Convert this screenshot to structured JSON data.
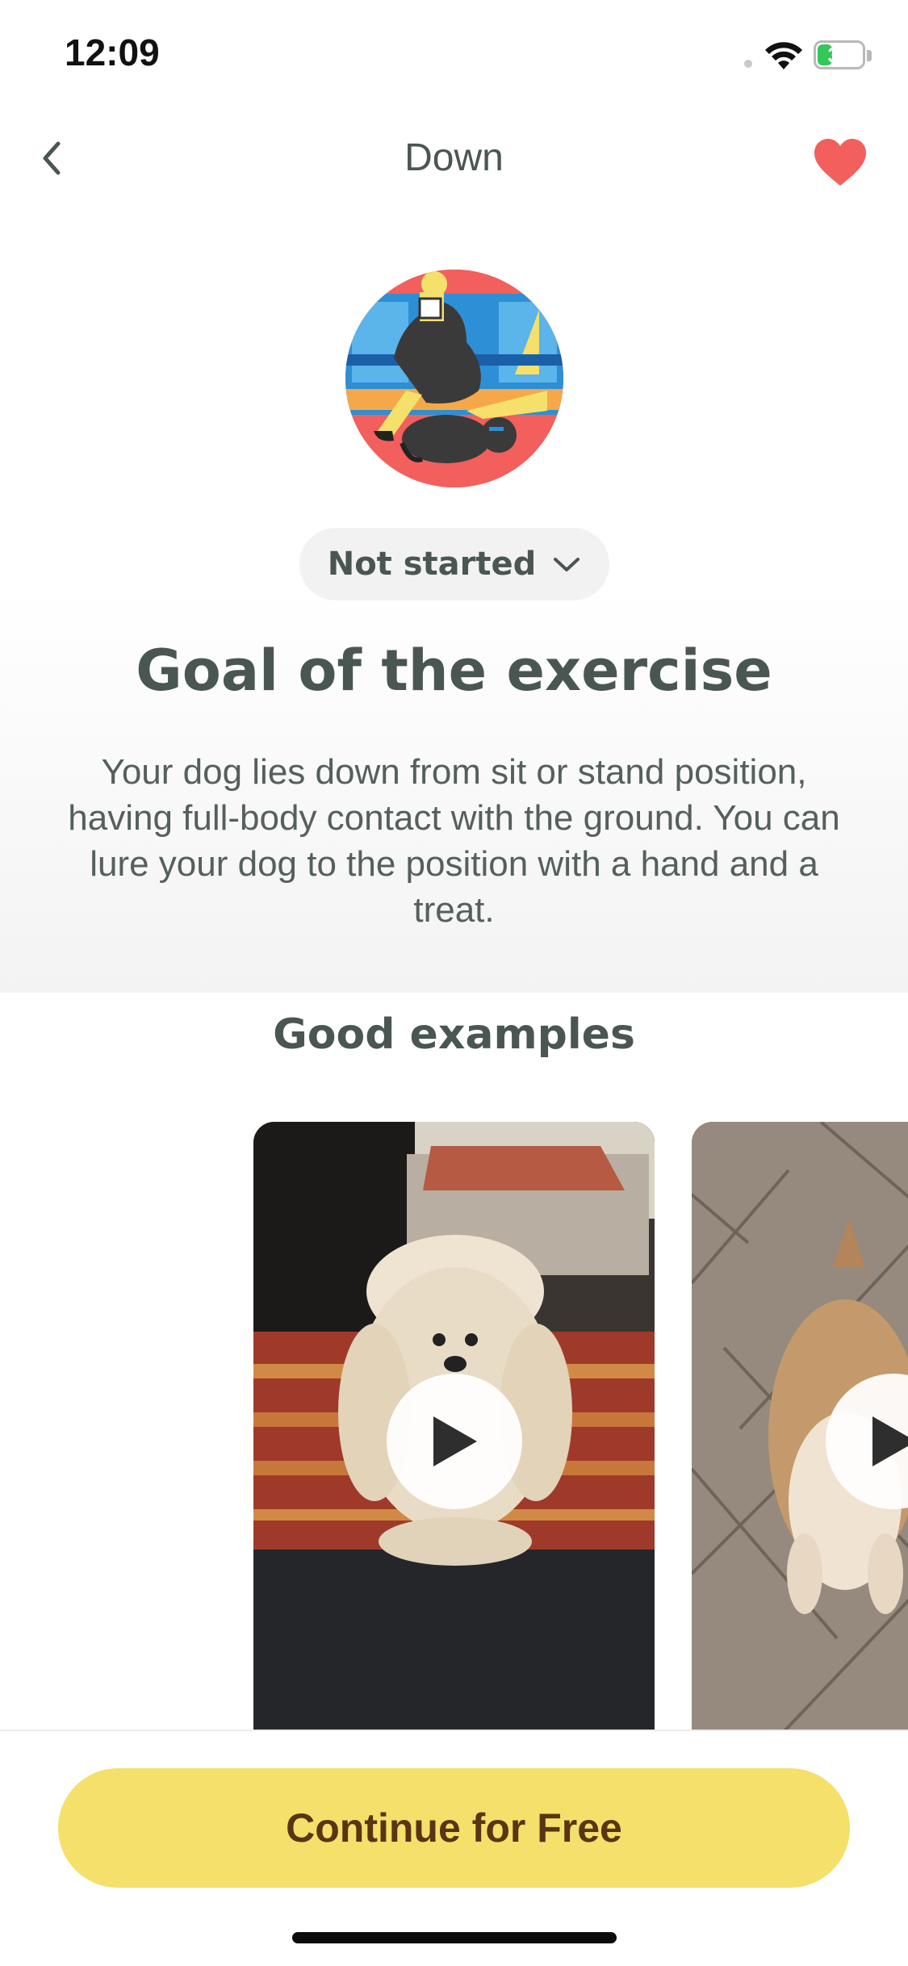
{
  "status_bar": {
    "time": "12:09",
    "battery": "34",
    "battery_level": 0.34
  },
  "nav": {
    "title": "Down",
    "back_icon": "chevron-left-icon",
    "favorite_icon": "heart-icon",
    "favorite_color": "#f25f5c"
  },
  "exercise": {
    "status_label": "Not started",
    "goal_title": "Goal of the exercise",
    "goal_text": "Your dog lies down from sit or stand position, having full-body contact with the ground. You can lure your dog to the position with a hand and a treat."
  },
  "examples": {
    "title": "Good examples",
    "videos": [
      {
        "play_icon": "play-icon"
      },
      {
        "play_icon": "play-icon"
      }
    ]
  },
  "cta": {
    "label": "Continue for Free",
    "color": "#f4e06a"
  },
  "colors": {
    "text": "#4a5651",
    "accent": "#f25f5c",
    "button": "#f4e06a"
  }
}
